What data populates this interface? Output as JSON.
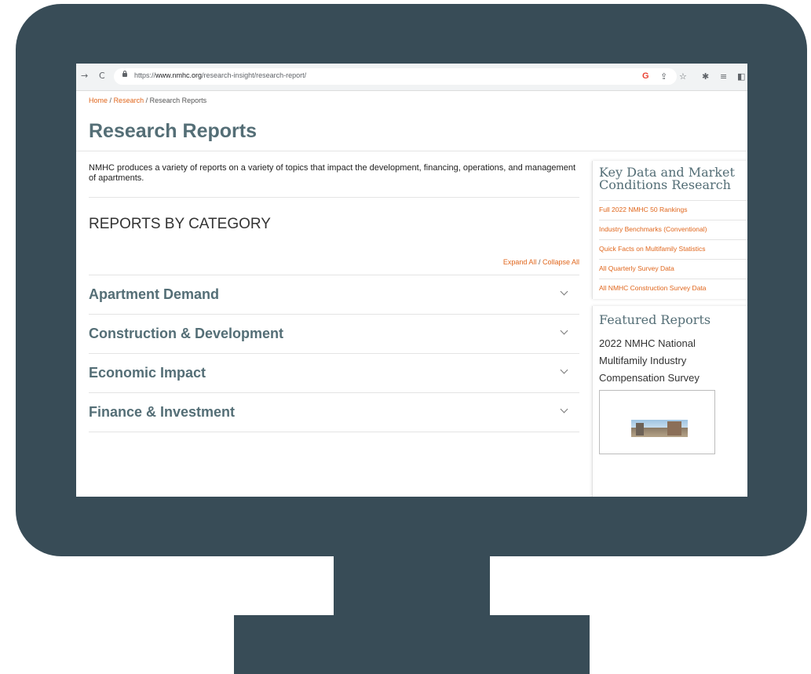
{
  "browser": {
    "back_glyph": "→",
    "reload_glyph": "C",
    "url_prefix": "https://",
    "url_domain": "www.nmhc.org",
    "url_path": "/research-insight/research-report/",
    "toolbar_icons": [
      "google-icon",
      "share-icon",
      "star-icon",
      "extensions-icon",
      "reading-list-icon",
      "side-panel-icon"
    ],
    "google_glyph": "G",
    "share_glyph": "⇪",
    "star_glyph": "☆",
    "extensions_glyph": "✱",
    "reading_list_glyph": "≡",
    "side_panel_glyph": "◧"
  },
  "breadcrumb": {
    "home": "Home",
    "research": "Research",
    "current": "Research Reports",
    "separator": "/"
  },
  "page": {
    "title": "Research Reports",
    "intro": "NMHC produces a variety of reports on a variety of topics that impact the development, financing, operations, and management of apartments.",
    "section_heading": "REPORTS BY CATEGORY",
    "expand_all": "Expand All",
    "collapse_all": "Collapse All",
    "toggle_separator": "/",
    "categories": [
      {
        "label": "Apartment Demand"
      },
      {
        "label": "Construction & Development"
      },
      {
        "label": "Economic Impact"
      },
      {
        "label": "Finance & Investment"
      }
    ]
  },
  "sidebar": {
    "key_data_title": "Key Data and Market Conditions Research",
    "key_data_links": [
      "Full 2022 NMHC 50 Rankings",
      "Industry Benchmarks (Conventional)",
      "Quick Facts on Multifamily Statistics",
      "All Quarterly Survey Data",
      "All NMHC Construction Survey Data"
    ],
    "featured_title": "Featured Reports",
    "featured_report": "2022 NMHC National Multifamily Industry Compensation Survey"
  },
  "colors": {
    "monitor": "#384c57",
    "heading": "#546e76",
    "link_orange": "#e0661c"
  }
}
